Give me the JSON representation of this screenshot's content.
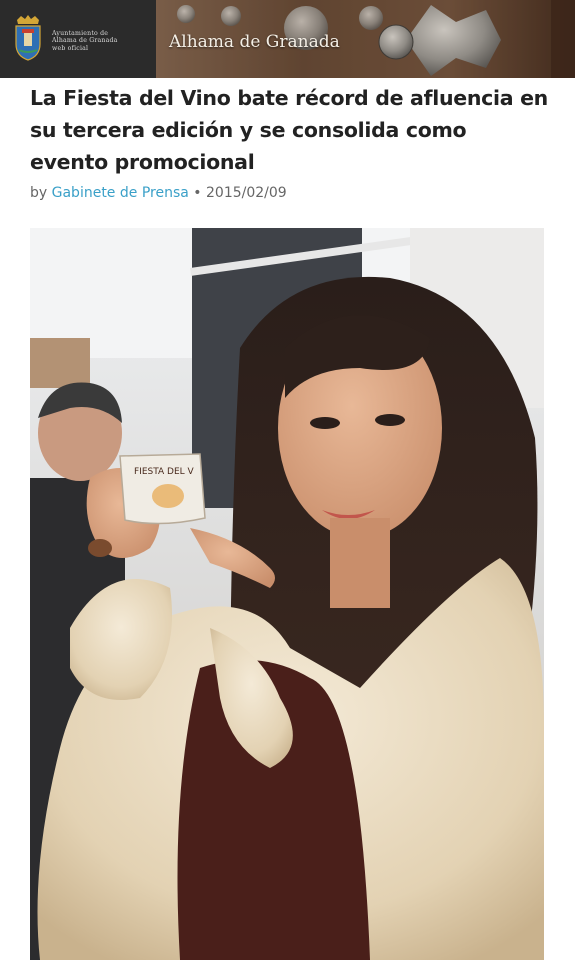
{
  "header": {
    "logo_lines": [
      "Ayuntamiento de",
      "Alhama de Granada",
      "web oficial"
    ],
    "site_name": "Alhama de Granada"
  },
  "article": {
    "title": "La Fiesta del Vino bate récord de afluencia en su tercera edición y se consolida como evento promocional",
    "byline_prefix": "by",
    "author": "Gabinete de Prensa",
    "separator": "•",
    "date": "2015/02/09",
    "photo_cup_text": "FIESTA DEL V"
  },
  "colors": {
    "header_bg": "#2b2b2b",
    "link": "#3aa0c8",
    "title": "#222222"
  }
}
